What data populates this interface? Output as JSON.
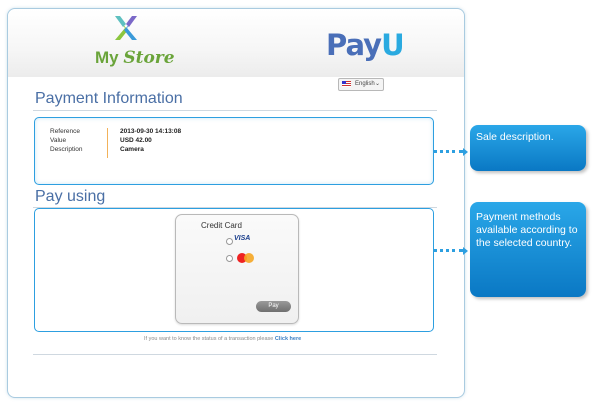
{
  "store": {
    "name_plain": "My ",
    "name_italic": "Store"
  },
  "brand": {
    "name_left": "Pay",
    "name_right": "U"
  },
  "language": {
    "selected": "English",
    "chevron": "⌄"
  },
  "payment_info": {
    "title": "Payment Information",
    "rows": [
      {
        "label": "Reference",
        "value": "2013-09-30 14:13:08"
      },
      {
        "label": "Value",
        "value": "USD 42.00"
      },
      {
        "label": "Description",
        "value": "Camera"
      }
    ]
  },
  "pay_using": {
    "title": "Pay using",
    "method_title": "Credit Card",
    "visa_label": "VISA",
    "pay_button": "Pay"
  },
  "status": {
    "text": "If you want to know the status of a transaction please",
    "link": "Click here"
  },
  "callouts": {
    "sale": "Sale description.",
    "methods": "Payment methods available according to the selected country."
  },
  "colors": {
    "accent": "#2d9fe0",
    "title": "#4a6fa5",
    "store_green": "#6aa43a",
    "payu_blue": "#4a6fb8"
  },
  "icons": [
    "mystore-x-logo-icon",
    "us-flag-icon",
    "chevron-down-icon",
    "visa-icon",
    "mastercard-icon"
  ]
}
